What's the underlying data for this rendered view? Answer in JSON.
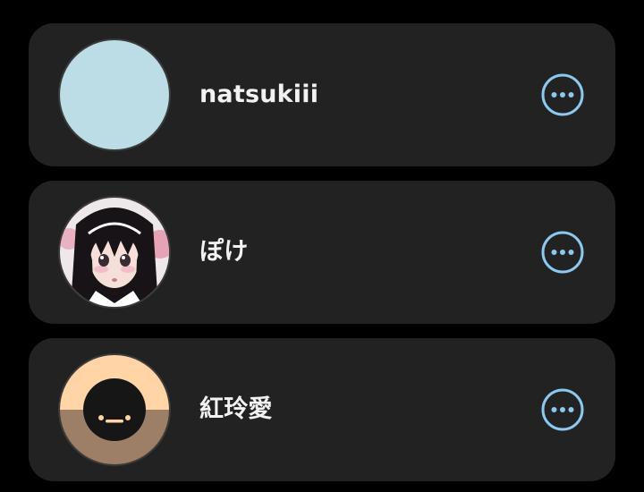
{
  "colors": {
    "background": "#000000",
    "card": "#222222",
    "text": "#f2f2f2",
    "accent": "#8cc8f0"
  },
  "users": [
    {
      "name": "natsukiii",
      "avatar": "light-blue-circle",
      "action_icon": "more-options-icon"
    },
    {
      "name": "ぽけ",
      "avatar": "anime-girl-portrait",
      "action_icon": "more-options-icon"
    },
    {
      "name": "紅玲愛",
      "avatar": "default-face-avatar",
      "action_icon": "more-options-icon"
    }
  ]
}
